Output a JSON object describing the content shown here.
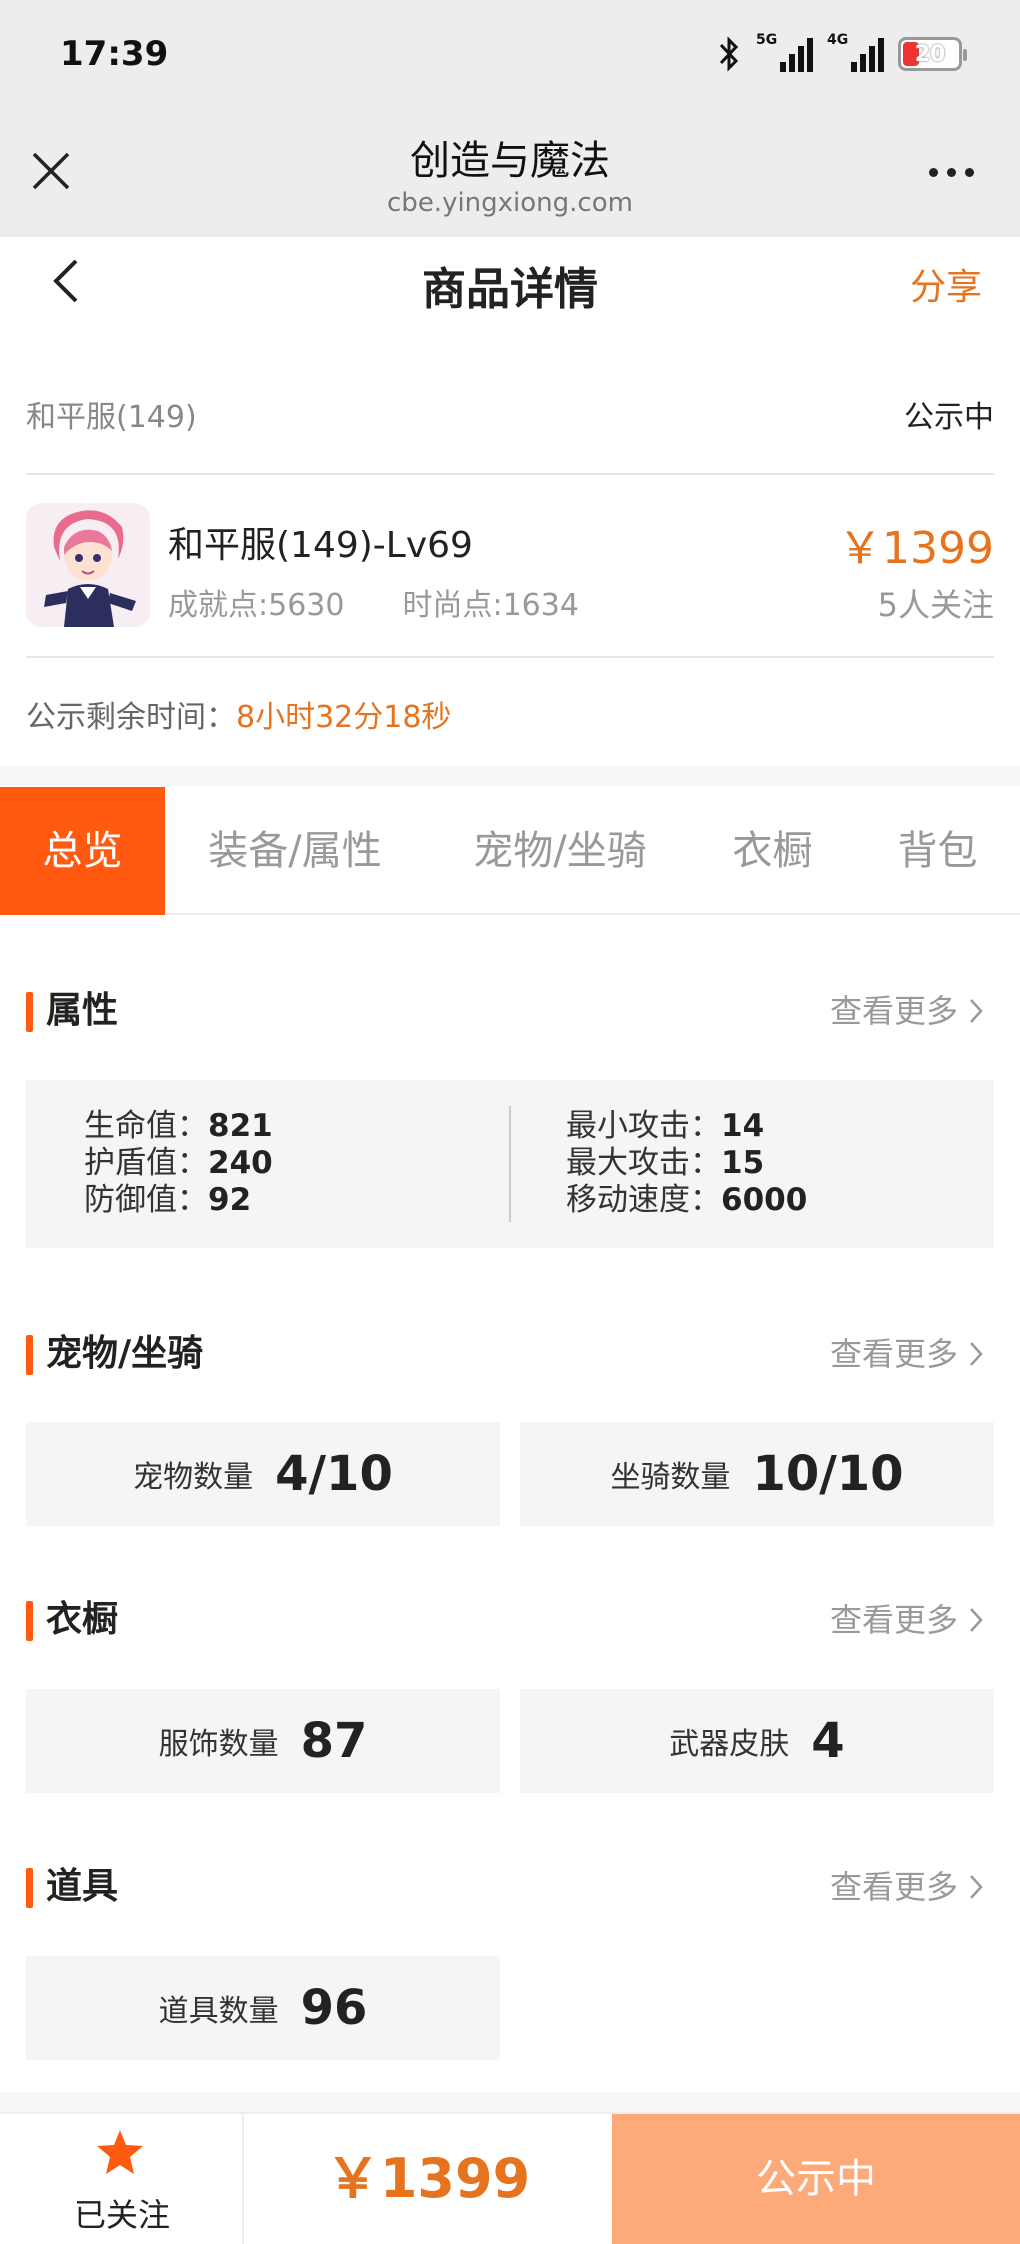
{
  "status_bar": {
    "time": "17:39",
    "signal1_label": "5G",
    "signal2_label": "4G",
    "battery": "20"
  },
  "browser": {
    "title": "创造与魔法",
    "url": "cbe.yingxiong.com"
  },
  "nav": {
    "title": "商品详情",
    "share": "分享"
  },
  "listing": {
    "server": "和平服(149)",
    "status": "公示中",
    "name": "和平服(149)-Lv69",
    "achievement": "成就点:5630",
    "fashion": "时尚点:1634",
    "price": "￥1399",
    "followers": "5人关注",
    "remain_label": "公示剩余时间：",
    "remain_value": "8小时32分18秒"
  },
  "tabs": [
    "总览",
    "装备/属性",
    "宠物/坐骑",
    "衣橱",
    "背包"
  ],
  "sections": {
    "attributes": {
      "title": "属性",
      "more": "查看更多",
      "left": [
        {
          "label": "生命值：",
          "value": "821"
        },
        {
          "label": "护盾值：",
          "value": "240"
        },
        {
          "label": "防御值：",
          "value": "92"
        }
      ],
      "right": [
        {
          "label": "最小攻击：",
          "value": "14"
        },
        {
          "label": "最大攻击：",
          "value": "15"
        },
        {
          "label": "移动速度：",
          "value": "6000"
        }
      ]
    },
    "pets": {
      "title": "宠物/坐骑",
      "more": "查看更多",
      "cards": [
        {
          "label": "宠物数量",
          "value": "4/10"
        },
        {
          "label": "坐骑数量",
          "value": "10/10"
        }
      ]
    },
    "wardrobe": {
      "title": "衣橱",
      "more": "查看更多",
      "cards": [
        {
          "label": "服饰数量",
          "value": "87"
        },
        {
          "label": "武器皮肤",
          "value": "4"
        }
      ]
    },
    "items": {
      "title": "道具",
      "more": "查看更多",
      "cards": [
        {
          "label": "道具数量",
          "value": "96"
        }
      ]
    }
  },
  "bottom_bar": {
    "follow_label": "已关注",
    "price": "￥1399",
    "status": "公示中"
  },
  "colors": {
    "accent": "#ff5a0f",
    "price": "#e6731d",
    "status_button": "#fcaa7a"
  }
}
